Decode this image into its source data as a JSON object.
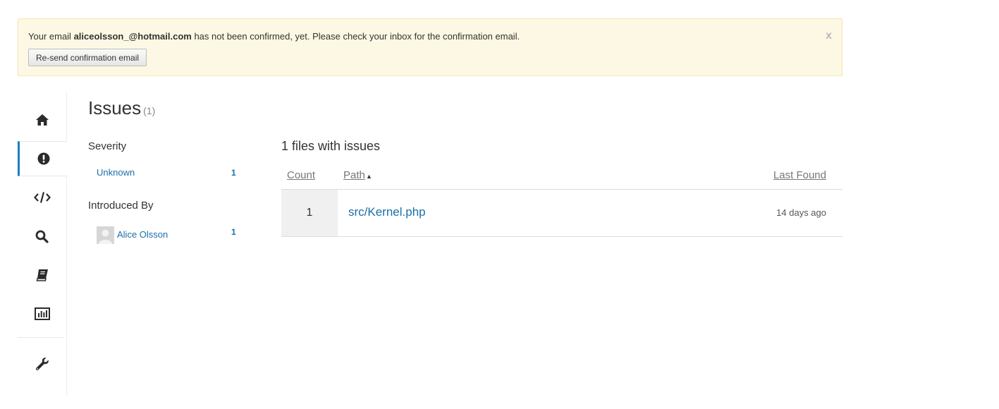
{
  "alert": {
    "prefix": "Your email ",
    "email": "aliceolsson_@hotmail.com",
    "suffix": " has not been confirmed, yet. Please check your inbox for the confirmation email.",
    "resend_label": "Re-send confirmation email",
    "close_label": "x"
  },
  "sidenav": {
    "items": [
      {
        "icon": "home-icon",
        "active": false
      },
      {
        "icon": "issues-icon",
        "active": true
      },
      {
        "icon": "code-icon",
        "active": false
      },
      {
        "icon": "search-icon",
        "active": false
      },
      {
        "icon": "book-icon",
        "active": false
      },
      {
        "icon": "chart-icon",
        "active": false
      },
      {
        "icon": "wrench-icon",
        "active": false
      }
    ]
  },
  "page": {
    "title": "Issues",
    "count": "(1)"
  },
  "filters": {
    "severity": {
      "heading": "Severity",
      "items": [
        {
          "label": "Unknown",
          "count": "1"
        }
      ]
    },
    "introduced_by": {
      "heading": "Introduced By",
      "items": [
        {
          "label": "Alice Olsson",
          "count": "1"
        }
      ]
    }
  },
  "files": {
    "heading": "1 files with issues",
    "columns": {
      "count": "Count",
      "path": "Path",
      "path_sort": "▲",
      "last_found": "Last Found"
    },
    "rows": [
      {
        "count": "1",
        "path": "src/Kernel.php",
        "last_found": "14 days ago"
      }
    ]
  },
  "colors": {
    "accent": "#1a7fbf",
    "link": "#1a6fa8",
    "alert_bg": "#fcf8e3"
  }
}
